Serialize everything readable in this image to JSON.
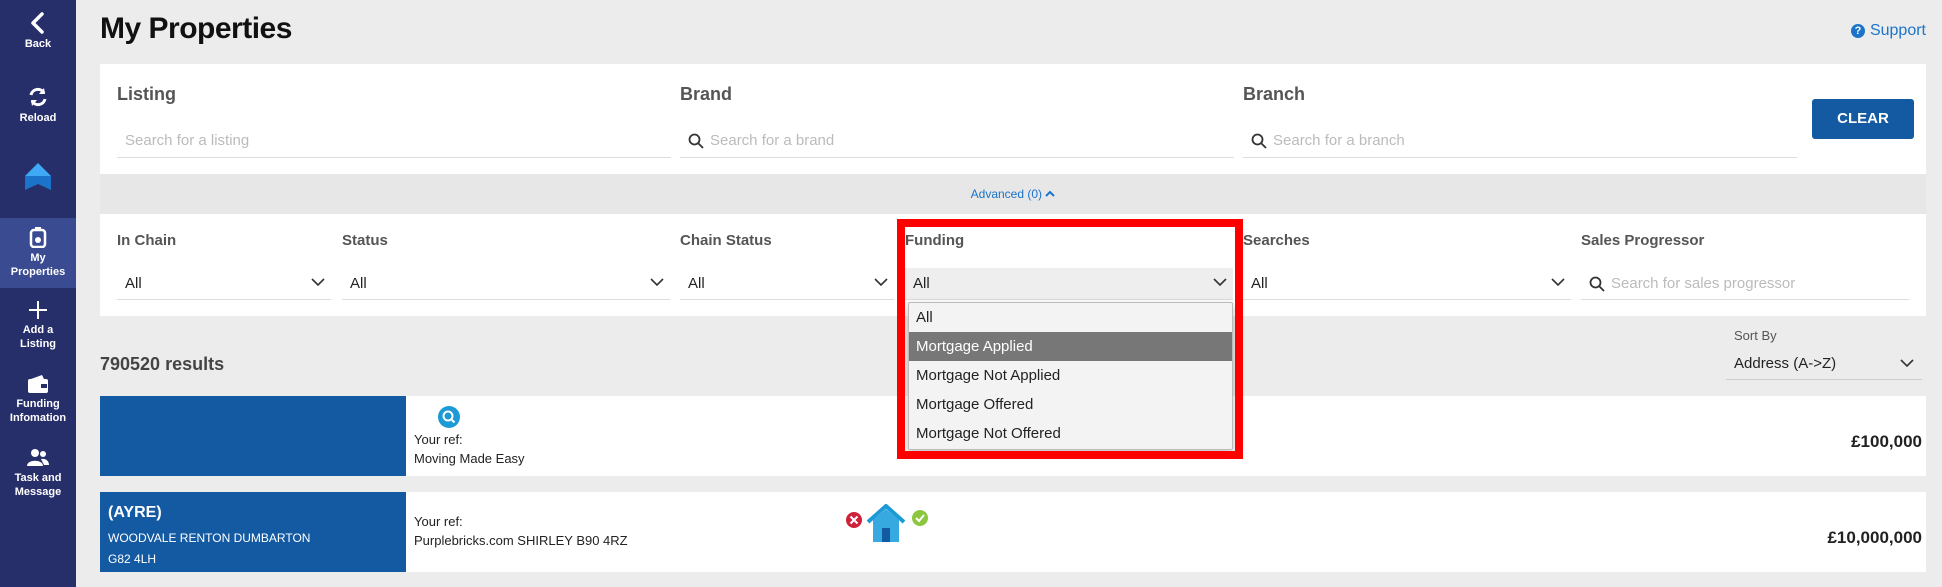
{
  "sidebar": {
    "items": [
      {
        "label_l1": "Back",
        "label_l2": "",
        "icon": "chevron-left-icon"
      },
      {
        "label_l1": "Reload",
        "label_l2": "",
        "icon": "reload-icon"
      },
      {
        "label_l1": "",
        "label_l2": "",
        "icon": "logo-icon"
      },
      {
        "label_l1": "My",
        "label_l2": "Properties",
        "icon": "house-badge-icon"
      },
      {
        "label_l1": "Add a",
        "label_l2": "Listing",
        "icon": "plus-icon"
      },
      {
        "label_l1": "Funding",
        "label_l2": "Infomation",
        "icon": "wallet-icon"
      },
      {
        "label_l1": "Task and",
        "label_l2": "Message",
        "icon": "users-icon"
      }
    ]
  },
  "header": {
    "title": "My Properties",
    "support_label": "Support"
  },
  "filters": {
    "listing": {
      "label": "Listing",
      "placeholder": "Search for a listing"
    },
    "brand": {
      "label": "Brand",
      "placeholder": "Search for a brand"
    },
    "branch": {
      "label": "Branch",
      "placeholder": "Search for a branch"
    },
    "clear_label": "CLEAR"
  },
  "advanced": {
    "toggle_label": "Advanced (0)",
    "in_chain": {
      "label": "In Chain",
      "value": "All"
    },
    "status": {
      "label": "Status",
      "value": "All"
    },
    "chain_status": {
      "label": "Chain Status",
      "value": "All"
    },
    "funding": {
      "label": "Funding",
      "value": "All",
      "options": [
        "All",
        "Mortgage Applied",
        "Mortgage Not Applied",
        "Mortgage Offered",
        "Mortgage Not Offered"
      ],
      "highlighted_option": "Mortgage Applied"
    },
    "searches": {
      "label": "Searches",
      "value": "All"
    },
    "sales_progressor": {
      "label": "Sales Progressor",
      "placeholder": "Search for sales progressor"
    }
  },
  "results": {
    "count_text": "790520 results",
    "sort_label": "Sort By",
    "sort_value": "Address (A->Z)"
  },
  "properties": [
    {
      "addr_title": "",
      "addr_line1": "",
      "addr_line2": "",
      "ref_label": "Your ref:",
      "ref_value": "Moving Made Easy",
      "price": "£100,000"
    },
    {
      "addr_title": "(AYRE)",
      "addr_line1": "WOODVALE RENTON DUMBARTON",
      "addr_line2": "G82 4LH",
      "ref_label": "Your ref:",
      "ref_value": "Purplebricks.com SHIRLEY B90 4RZ",
      "price": "£10,000,000"
    }
  ],
  "colors": {
    "sidebar_bg": "#272f6b",
    "accent_blue": "#135aa3",
    "link_blue": "#1b74c9",
    "highlight_red": "#ff0000"
  }
}
